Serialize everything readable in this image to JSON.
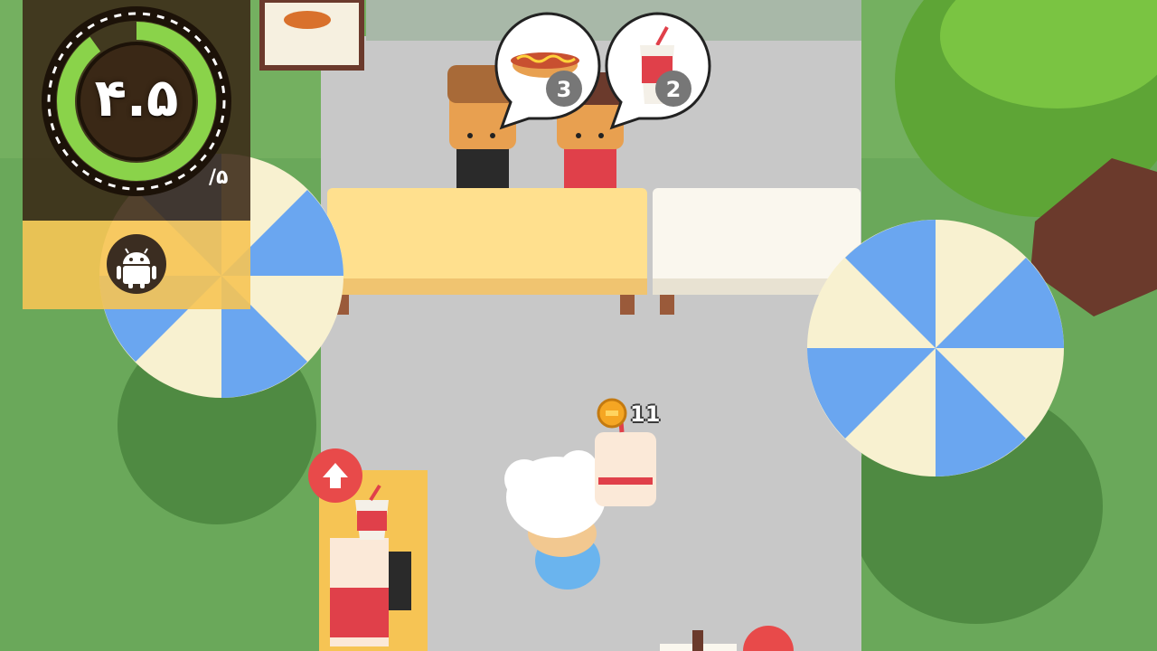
{
  "hud": {
    "rating": "۴.۵",
    "rating_max": "/۵",
    "rating_fraction": 0.9,
    "platform_icon": "android-icon"
  },
  "orders": [
    {
      "item": "hotdog",
      "icon": "hotdog-icon",
      "count": "3"
    },
    {
      "item": "soda",
      "icon": "soda-cup-icon",
      "count": "2"
    }
  ],
  "coins": {
    "icon": "coin-icon",
    "count": "11"
  },
  "colors": {
    "hud_dark": "#3a2816",
    "hud_accent": "#f6c454",
    "rating_ring": "#8ad34a",
    "upgrade_button": "#e84a4a",
    "umbrella_blue": "#6aa6f0",
    "umbrella_cream": "#f8f1d0"
  }
}
